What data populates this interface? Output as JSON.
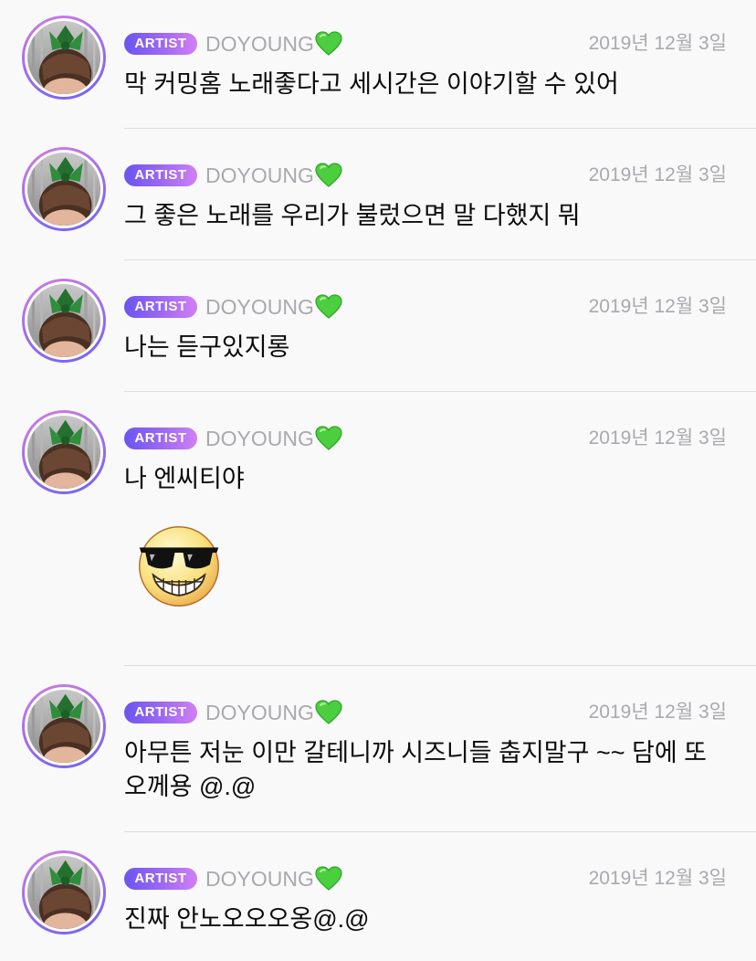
{
  "colors": {
    "background": "#f9f9fa",
    "badge_start": "#6a55f0",
    "badge_end": "#d27ff4",
    "meta_text": "#a9a9ae",
    "heart_green": "#4ccf3e",
    "divider": "#dedee2"
  },
  "messages": [
    {
      "badge": "ARTIST",
      "author": "DOYOUNG",
      "heart_icon": "green-heart-icon",
      "date": "2019년 12월 3일",
      "text": "막 커밍홈 노래좋다고 세시간은 이야기할 수 있어"
    },
    {
      "badge": "ARTIST",
      "author": "DOYOUNG",
      "heart_icon": "green-heart-icon",
      "date": "2019년 12월 3일",
      "text": "그 좋은 노래를 우리가 불렀으면 말 다했지 뭐"
    },
    {
      "badge": "ARTIST",
      "author": "DOYOUNG",
      "heart_icon": "green-heart-icon",
      "date": "2019년 12월 3일",
      "text": "나는 듣구있지롱"
    },
    {
      "badge": "ARTIST",
      "author": "DOYOUNG",
      "heart_icon": "green-heart-icon",
      "date": "2019년 12월 3일",
      "text": "나 엔씨티야",
      "sticker": "sunglasses-grin-emoji"
    },
    {
      "badge": "ARTIST",
      "author": "DOYOUNG",
      "heart_icon": "green-heart-icon",
      "date": "2019년 12월 3일",
      "text": "아무튼 저눈 이만 갈테니까 시즈니들 춥지말구 ~~ 담에 또 오께용 @.@"
    },
    {
      "badge": "ARTIST",
      "author": "DOYOUNG",
      "heart_icon": "green-heart-icon",
      "date": "2019년 12월 3일",
      "text": "진짜 안노오오오옹@.@"
    }
  ]
}
